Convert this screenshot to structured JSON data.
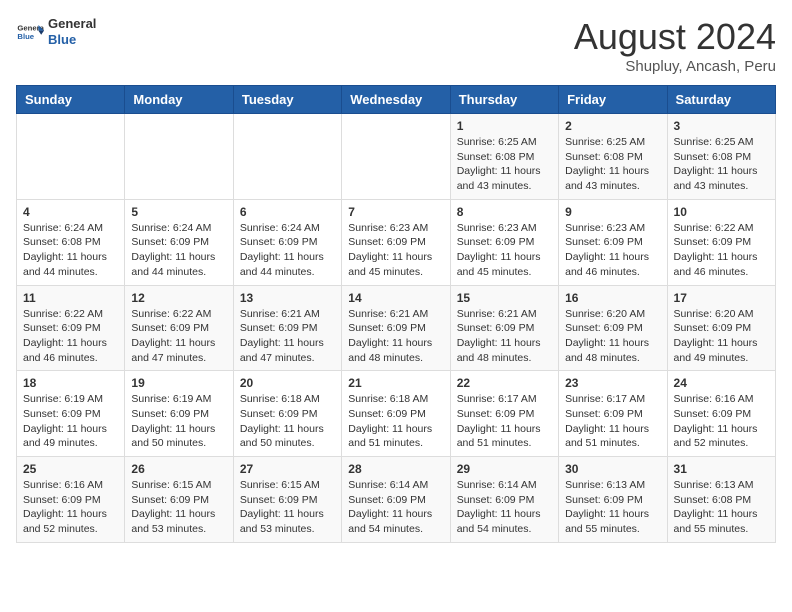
{
  "header": {
    "logo": {
      "general": "General",
      "blue": "Blue"
    },
    "title": "August 2024",
    "location": "Shupluy, Ancash, Peru"
  },
  "weekdays": [
    "Sunday",
    "Monday",
    "Tuesday",
    "Wednesday",
    "Thursday",
    "Friday",
    "Saturday"
  ],
  "weeks": [
    [
      {
        "day": "",
        "content": ""
      },
      {
        "day": "",
        "content": ""
      },
      {
        "day": "",
        "content": ""
      },
      {
        "day": "",
        "content": ""
      },
      {
        "day": "1",
        "content": "Sunrise: 6:25 AM\nSunset: 6:08 PM\nDaylight: 11 hours and 43 minutes."
      },
      {
        "day": "2",
        "content": "Sunrise: 6:25 AM\nSunset: 6:08 PM\nDaylight: 11 hours and 43 minutes."
      },
      {
        "day": "3",
        "content": "Sunrise: 6:25 AM\nSunset: 6:08 PM\nDaylight: 11 hours and 43 minutes."
      }
    ],
    [
      {
        "day": "4",
        "content": "Sunrise: 6:24 AM\nSunset: 6:08 PM\nDaylight: 11 hours and 44 minutes."
      },
      {
        "day": "5",
        "content": "Sunrise: 6:24 AM\nSunset: 6:09 PM\nDaylight: 11 hours and 44 minutes."
      },
      {
        "day": "6",
        "content": "Sunrise: 6:24 AM\nSunset: 6:09 PM\nDaylight: 11 hours and 44 minutes."
      },
      {
        "day": "7",
        "content": "Sunrise: 6:23 AM\nSunset: 6:09 PM\nDaylight: 11 hours and 45 minutes."
      },
      {
        "day": "8",
        "content": "Sunrise: 6:23 AM\nSunset: 6:09 PM\nDaylight: 11 hours and 45 minutes."
      },
      {
        "day": "9",
        "content": "Sunrise: 6:23 AM\nSunset: 6:09 PM\nDaylight: 11 hours and 46 minutes."
      },
      {
        "day": "10",
        "content": "Sunrise: 6:22 AM\nSunset: 6:09 PM\nDaylight: 11 hours and 46 minutes."
      }
    ],
    [
      {
        "day": "11",
        "content": "Sunrise: 6:22 AM\nSunset: 6:09 PM\nDaylight: 11 hours and 46 minutes."
      },
      {
        "day": "12",
        "content": "Sunrise: 6:22 AM\nSunset: 6:09 PM\nDaylight: 11 hours and 47 minutes."
      },
      {
        "day": "13",
        "content": "Sunrise: 6:21 AM\nSunset: 6:09 PM\nDaylight: 11 hours and 47 minutes."
      },
      {
        "day": "14",
        "content": "Sunrise: 6:21 AM\nSunset: 6:09 PM\nDaylight: 11 hours and 48 minutes."
      },
      {
        "day": "15",
        "content": "Sunrise: 6:21 AM\nSunset: 6:09 PM\nDaylight: 11 hours and 48 minutes."
      },
      {
        "day": "16",
        "content": "Sunrise: 6:20 AM\nSunset: 6:09 PM\nDaylight: 11 hours and 48 minutes."
      },
      {
        "day": "17",
        "content": "Sunrise: 6:20 AM\nSunset: 6:09 PM\nDaylight: 11 hours and 49 minutes."
      }
    ],
    [
      {
        "day": "18",
        "content": "Sunrise: 6:19 AM\nSunset: 6:09 PM\nDaylight: 11 hours and 49 minutes."
      },
      {
        "day": "19",
        "content": "Sunrise: 6:19 AM\nSunset: 6:09 PM\nDaylight: 11 hours and 50 minutes."
      },
      {
        "day": "20",
        "content": "Sunrise: 6:18 AM\nSunset: 6:09 PM\nDaylight: 11 hours and 50 minutes."
      },
      {
        "day": "21",
        "content": "Sunrise: 6:18 AM\nSunset: 6:09 PM\nDaylight: 11 hours and 51 minutes."
      },
      {
        "day": "22",
        "content": "Sunrise: 6:17 AM\nSunset: 6:09 PM\nDaylight: 11 hours and 51 minutes."
      },
      {
        "day": "23",
        "content": "Sunrise: 6:17 AM\nSunset: 6:09 PM\nDaylight: 11 hours and 51 minutes."
      },
      {
        "day": "24",
        "content": "Sunrise: 6:16 AM\nSunset: 6:09 PM\nDaylight: 11 hours and 52 minutes."
      }
    ],
    [
      {
        "day": "25",
        "content": "Sunrise: 6:16 AM\nSunset: 6:09 PM\nDaylight: 11 hours and 52 minutes."
      },
      {
        "day": "26",
        "content": "Sunrise: 6:15 AM\nSunset: 6:09 PM\nDaylight: 11 hours and 53 minutes."
      },
      {
        "day": "27",
        "content": "Sunrise: 6:15 AM\nSunset: 6:09 PM\nDaylight: 11 hours and 53 minutes."
      },
      {
        "day": "28",
        "content": "Sunrise: 6:14 AM\nSunset: 6:09 PM\nDaylight: 11 hours and 54 minutes."
      },
      {
        "day": "29",
        "content": "Sunrise: 6:14 AM\nSunset: 6:09 PM\nDaylight: 11 hours and 54 minutes."
      },
      {
        "day": "30",
        "content": "Sunrise: 6:13 AM\nSunset: 6:09 PM\nDaylight: 11 hours and 55 minutes."
      },
      {
        "day": "31",
        "content": "Sunrise: 6:13 AM\nSunset: 6:08 PM\nDaylight: 11 hours and 55 minutes."
      }
    ]
  ]
}
